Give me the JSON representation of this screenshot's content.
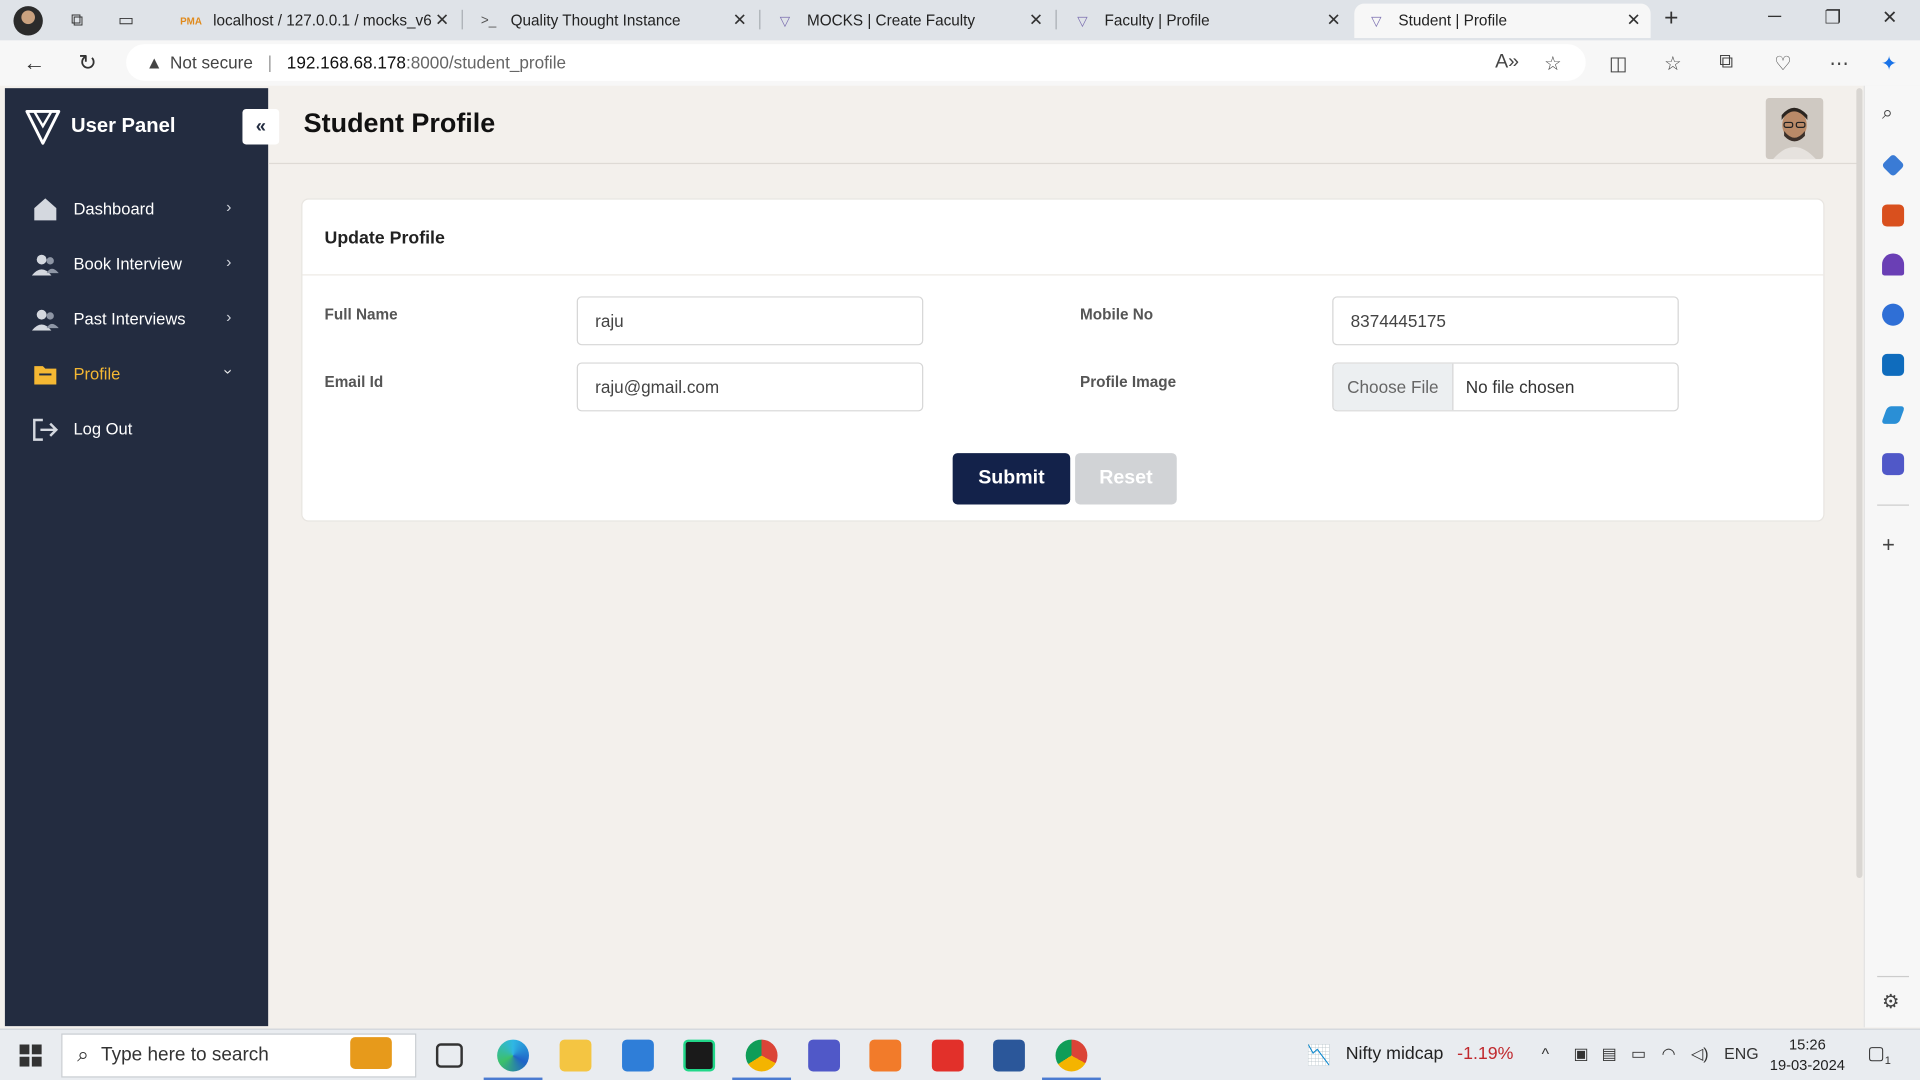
{
  "browser": {
    "tabs": [
      {
        "title": "localhost / 127.0.0.1 / mocks_v6",
        "favicon": "PMA"
      },
      {
        "title": "Quality Thought Instance"
      },
      {
        "title": "MOCKS | Create Faculty"
      },
      {
        "title": "Faculty | Profile"
      },
      {
        "title": "Student | Profile"
      }
    ],
    "security": "Not secure",
    "url_host": "192.168.68.178",
    "url_rest": ":8000/student_profile"
  },
  "sidebar": {
    "brand": "User Panel",
    "items": [
      {
        "label": "Dashboard",
        "icon": "home-icon"
      },
      {
        "label": "Book Interview",
        "icon": "users-icon"
      },
      {
        "label": "Past Interviews",
        "icon": "users-icon"
      },
      {
        "label": "Profile",
        "icon": "folder-icon"
      },
      {
        "label": "Log Out",
        "icon": "logout-icon"
      }
    ],
    "active_color": "#f5b833",
    "bg_color": "#232c40"
  },
  "page": {
    "title": "Student Profile",
    "card_title": "Update Profile",
    "form": {
      "full_name_label": "Full Name",
      "full_name_value": "raju",
      "email_label": "Email Id",
      "email_value": "raju@gmail.com",
      "mobile_label": "Mobile No",
      "mobile_value": "8374445175",
      "image_label": "Profile Image",
      "file_button": "Choose File",
      "file_status": "No file chosen"
    },
    "submit_label": "Submit",
    "reset_label": "Reset",
    "submit_color": "#13224a"
  },
  "taskbar": {
    "search_placeholder": "Type here to search",
    "stock_name": "Nifty midcap",
    "stock_change": "-1.19%",
    "lang": "ENG",
    "time": "15:26",
    "date": "19-03-2024",
    "notif_count": "1"
  }
}
